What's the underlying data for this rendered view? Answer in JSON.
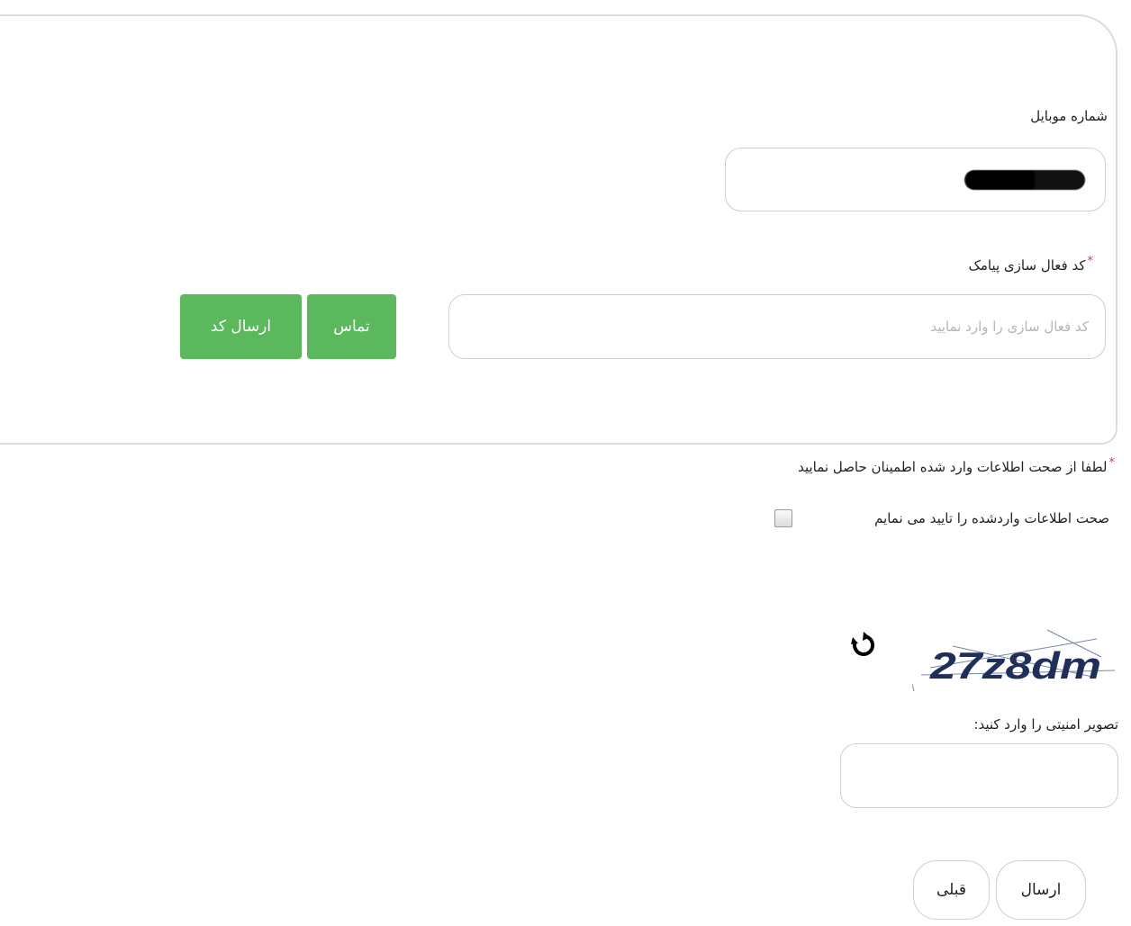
{
  "form": {
    "mobile_label": "شماره موبایل",
    "sms_code_label": "کد فعال سازی پیامک",
    "sms_code_placeholder": "کد فعال سازی را وارد نمایید",
    "send_code_button": "ارسال کد",
    "call_button": "تماس",
    "required_marker": "*",
    "confirm_heading": "لطفا از صحت اطلاعات وارد شده اطمینان حاصل نمایید",
    "confirm_checkbox_label": "صحت اطلاعات واردشده را تایید می نمایم",
    "confirm_checked": false,
    "captcha_text": "27z8dm",
    "captcha_label": "تصویر امنیتی را وارد کنید:",
    "captcha_input_value": "",
    "submit_button": "ارسال",
    "previous_button": "قبلی"
  },
  "colors": {
    "primary_green": "#5cb85c",
    "required_red": "#b94a48",
    "captcha_ink": "#1f2f5a"
  },
  "icons": {
    "refresh": "refresh-icon"
  }
}
